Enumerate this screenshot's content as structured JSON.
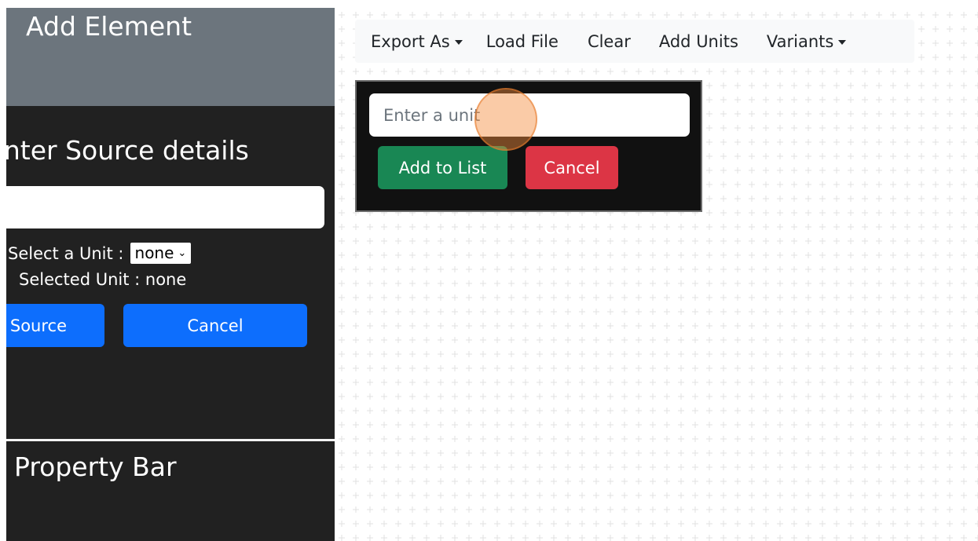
{
  "left_panel": {
    "add_element_title": "Add Element",
    "source_title": "Enter Source details",
    "source_input_value": "",
    "unit_label": "Select a Unit :",
    "unit_select_value": "none",
    "selected_unit_text": "Selected Unit : none",
    "add_source_label": "Add Source",
    "cancel_label": "Cancel",
    "property_bar_title": "Property Bar"
  },
  "toolbar": {
    "export_label": "Export As",
    "load_file_label": "Load File",
    "clear_label": "Clear",
    "add_units_label": "Add Units",
    "variants_label": "Variants"
  },
  "unit_popup": {
    "input_placeholder": "Enter a unit",
    "add_to_list_label": "Add to List",
    "cancel_label": "Cancel"
  },
  "colors": {
    "panel_bg": "#212121",
    "header_bg": "#6c757d",
    "primary": "#0d6efd",
    "success": "#198754",
    "danger": "#dc3545",
    "highlight": "#f58c3c"
  }
}
